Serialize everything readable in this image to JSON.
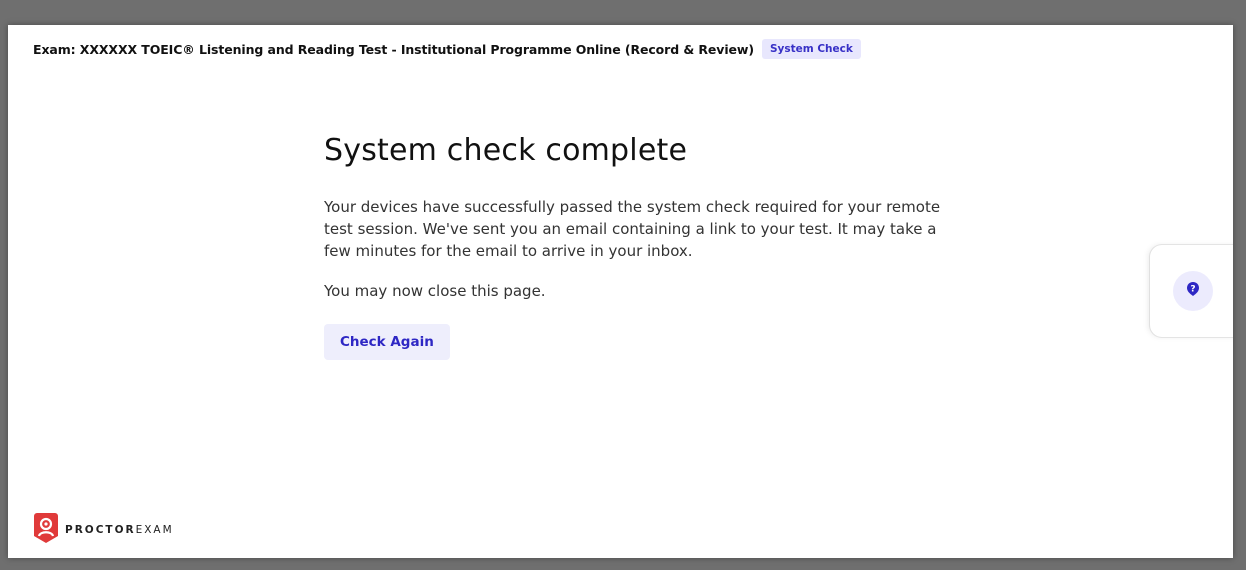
{
  "header": {
    "exam_title": "Exam: XXXXXX TOEIC® Listening and Reading Test - Institutional Programme Online (Record & Review)",
    "badge": "System Check"
  },
  "main": {
    "title": "System check complete",
    "paragraph1": "Your devices have successfully passed the system check required for your remote test session. We've sent you an email containing a link to your test. It may take a few minutes for the email to arrive in your inbox.",
    "paragraph2": "You may now close this page.",
    "check_again_label": "Check Again"
  },
  "help": {
    "icon": "question-icon"
  },
  "logo": {
    "bold": "PROCTOR",
    "light": "EXAM",
    "icon": "proctorexam-logo-icon"
  },
  "colors": {
    "accent": "#2e27c4",
    "badge_bg": "#e8e7fd",
    "logo_red": "#e03a3a"
  }
}
